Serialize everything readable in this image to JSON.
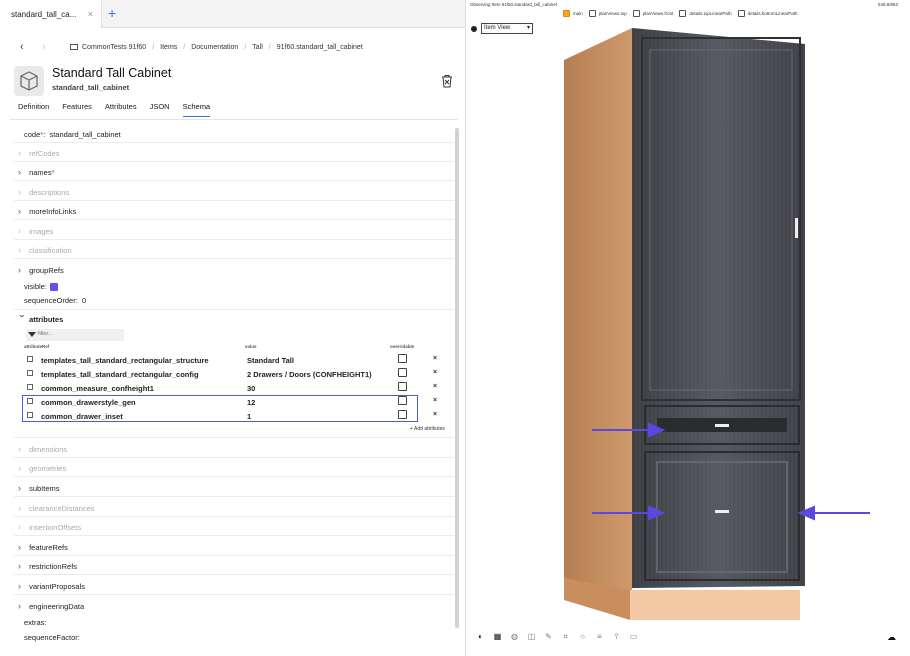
{
  "tab": {
    "title": "standard_tall_ca...",
    "close": "×",
    "add": "+"
  },
  "breadcrumb": {
    "back": "‹",
    "forward": "›",
    "items": [
      "CommonTests 91f60",
      "Items",
      "Documentation",
      "Tall",
      "91f60.standard_tall_cabinet"
    ]
  },
  "header": {
    "title": "Standard Tall Cabinet",
    "subtitle": "standard_tall_cabinet",
    "delete_icon": "trash-icon"
  },
  "tabs": [
    "Definition",
    "Features",
    "Attributes",
    "JSON",
    "Schema"
  ],
  "active_tab": "Schema",
  "schema": {
    "code_label": "code",
    "code_value": "standard_tall_cabinet",
    "refCodes": "refCodes",
    "names": "names",
    "descriptions": "descriptions",
    "moreInfoLinks": "moreInfoLinks",
    "images": "images",
    "classification": "classification",
    "groupRefs": "groupRefs",
    "visible_label": "visible:",
    "visible_value": true,
    "sequenceOrder_label": "sequenceOrder:",
    "sequenceOrder_value": "0",
    "attributes": "attributes",
    "filter_placeholder": "filter...",
    "table_headers": {
      "ref": "attributeRef",
      "value": "value",
      "overridable": "overridable"
    },
    "rows": [
      {
        "ref": "templates_tall_standard_rectangular_structure",
        "value": "Standard Tall",
        "overridable": false
      },
      {
        "ref": "templates_tall_standard_rectangular_config",
        "value": "2 Drawers / Doors (CONFHEIGHT1)",
        "overridable": false
      },
      {
        "ref": "common_measure_confheight1",
        "value": "30",
        "overridable": false
      },
      {
        "ref": "common_drawerstyle_gen",
        "value": "12",
        "overridable": false
      },
      {
        "ref": "common_drawer_inset",
        "value": "1",
        "overridable": false
      }
    ],
    "remove": "×",
    "add_attributes": "+ Add attributes",
    "dimensions": "dimensions",
    "geometries": "geometries",
    "subItems": "subItems",
    "clearanceDistances": "clearanceDistances",
    "insertionOffsets": "insertionOffsets",
    "featureRefs": "featureRefs",
    "restrictionRefs": "restrictionRefs",
    "variantProposals": "variantProposals",
    "engineeringData": "engineeringData",
    "extras_label": "extras:",
    "sequenceFactor_label": "sequenceFactor:"
  },
  "viewer": {
    "status": "Observing Item 91f60.standard_tall_cabinet",
    "zoom": "548.8/862",
    "layers": [
      {
        "label": "main",
        "checked": true
      },
      {
        "label": "planViews.top",
        "checked": false
      },
      {
        "label": "planViews.front",
        "checked": false
      },
      {
        "label": "details.topLinearPath",
        "checked": false
      },
      {
        "label": "details.bottomLinearPath",
        "checked": false
      }
    ],
    "view_select": "Item View",
    "dropdown_arrow": "▾",
    "toolbar_icons": [
      "camera-icon",
      "grid-icon",
      "render-icon",
      "cube-icon",
      "brush-icon",
      "crop-icon",
      "circle-icon",
      "list-icon",
      "hierarchy-icon",
      "layers-icon"
    ],
    "toolbar_glyphs": [
      "◐",
      "▦",
      "◍",
      "◫",
      "✎",
      "⌗",
      "○",
      "≡",
      "⫯",
      "▭"
    ],
    "cloud": "☁",
    "colors": {
      "accent": "#5a48e0",
      "cabinet_front": "#4a4c52",
      "cabinet_side": "#c0895a",
      "base": "#f2c9a2"
    }
  }
}
